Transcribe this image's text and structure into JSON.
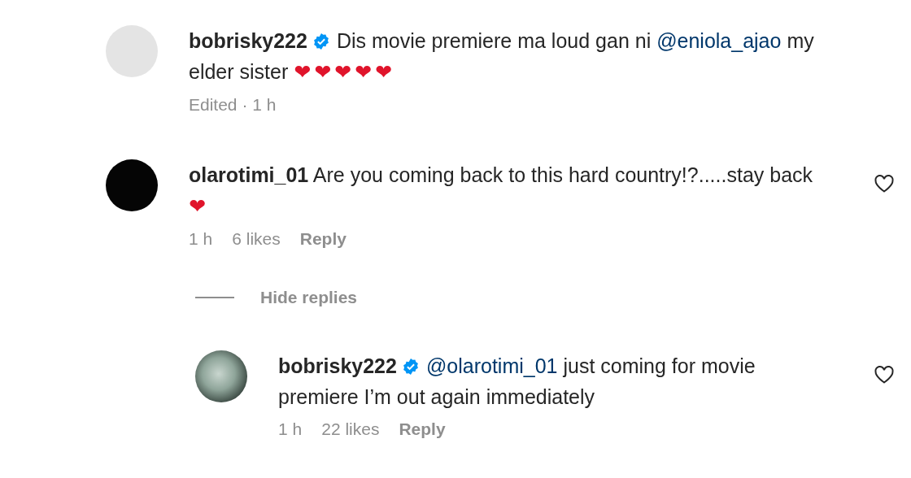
{
  "comments": [
    {
      "avatar": {
        "kind": "blank"
      },
      "username": "bobrisky222",
      "verified": true,
      "segments": [
        {
          "kind": "text",
          "text": "Dis movie premiere ma loud gan ni "
        },
        {
          "kind": "mention",
          "text": "@eniola_ajao"
        },
        {
          "kind": "text",
          "text": " my elder sister "
        },
        {
          "kind": "emoji",
          "text": "❤❤❤❤❤"
        }
      ],
      "meta": [
        "Edited · 1 h"
      ],
      "like": false
    },
    {
      "avatar": {
        "kind": "dark"
      },
      "username": "olarotimi_01",
      "verified": false,
      "segments": [
        {
          "kind": "text",
          "text": "Are you coming back to this hard country!?.....stay back "
        },
        {
          "kind": "emoji",
          "text": "❤"
        }
      ],
      "meta": [
        "1 h",
        "6 likes"
      ],
      "reply_label": "Reply",
      "like": true,
      "toggle": "Hide replies",
      "replies": [
        {
          "avatar": {
            "kind": "photo"
          },
          "username": "bobrisky222",
          "verified": true,
          "segments": [
            {
              "kind": "mention",
              "text": "@olarotimi_01"
            },
            {
              "kind": "text",
              "text": " just coming for movie premiere I’m out again immediately"
            }
          ],
          "meta": [
            "1 h",
            "22 likes"
          ],
          "reply_label": "Reply",
          "like": true
        }
      ]
    }
  ]
}
